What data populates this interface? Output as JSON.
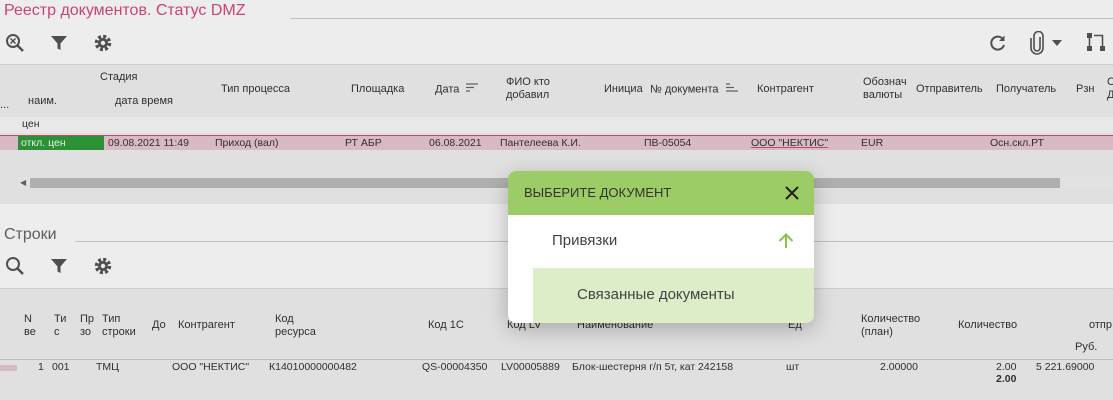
{
  "page_title": "Реестр документов. Статус DMZ",
  "toolbar_icons": [
    "search-clear-icon",
    "filter-icon",
    "settings-icon",
    "refresh-icon",
    "attachment-icon",
    "dropdown-icon",
    "workflow-icon"
  ],
  "registry": {
    "headers": {
      "ellipsis": "...",
      "stage": "Стадия",
      "stage_name": "наим.",
      "stage_datetime": "дата время",
      "process_type": "Тип процесса",
      "site": "Площадка",
      "date": "Дата",
      "added_by": "ФИО кто добавил",
      "initiator": "Инициа",
      "doc_number": "№ документа",
      "counterparty": "Контрагент",
      "currency": "Обознач валюты",
      "sender": "Отправитель",
      "receiver": "Получатель",
      "rzn": "Рзн",
      "extra": "С Д"
    },
    "filter_value": "цен",
    "row": {
      "stage_name": "откл. цен",
      "stage_datetime": "09.08.2021 11:49",
      "process_type": "Приход (вал)",
      "site": "РТ АБР",
      "date": "06.08.2021",
      "added_by": "Пантелеева К.И.",
      "doc_number": "ПВ-05054",
      "counterparty": "ООО \"НЕКТИС\"",
      "currency": "EUR",
      "receiver": "Осн.скл.РТ"
    },
    "colors": {
      "status_green": "#2e9e3a",
      "selected_row": "#e9c9d3",
      "title_pink": "#d84a7a"
    }
  },
  "lines": {
    "title": "Строки",
    "headers": {
      "num": "N ве",
      "t": "Ти с",
      "pr": "Пр зо",
      "line_type": "Тип строки",
      "doc": "До",
      "counterparty": "Контрагент",
      "resource_code": "Код ресурса",
      "code_1c": "Код 1С",
      "code_lv": "Код LV",
      "name": "Наименование",
      "unit": "Ед",
      "qty_plan": "Количество (план)",
      "qty": "Количество",
      "shipped": "отпр",
      "rub": "Руб."
    },
    "row": {
      "num": "1",
      "t": "001",
      "line_type": "ТМЦ",
      "counterparty": "ООО \"НЕКТИС\"",
      "resource_code": "К14010000000482",
      "code_1c": "QS-00004350",
      "code_lv": "LV00005889",
      "name": "Блок-шестерня г/п 5т, кат 242158",
      "unit": "шт",
      "qty_plan": "2.00000",
      "qty": "2.00",
      "amount": "5 221.69000"
    },
    "total_qty": "2.00"
  },
  "modal": {
    "title": "ВЫБЕРИТЕ ДОКУМЕНТ",
    "items": [
      {
        "label": "Привязки"
      },
      {
        "label": "Связанные документы"
      }
    ],
    "header_color": "#9ccc65",
    "selected_color": "#dcedc8"
  }
}
